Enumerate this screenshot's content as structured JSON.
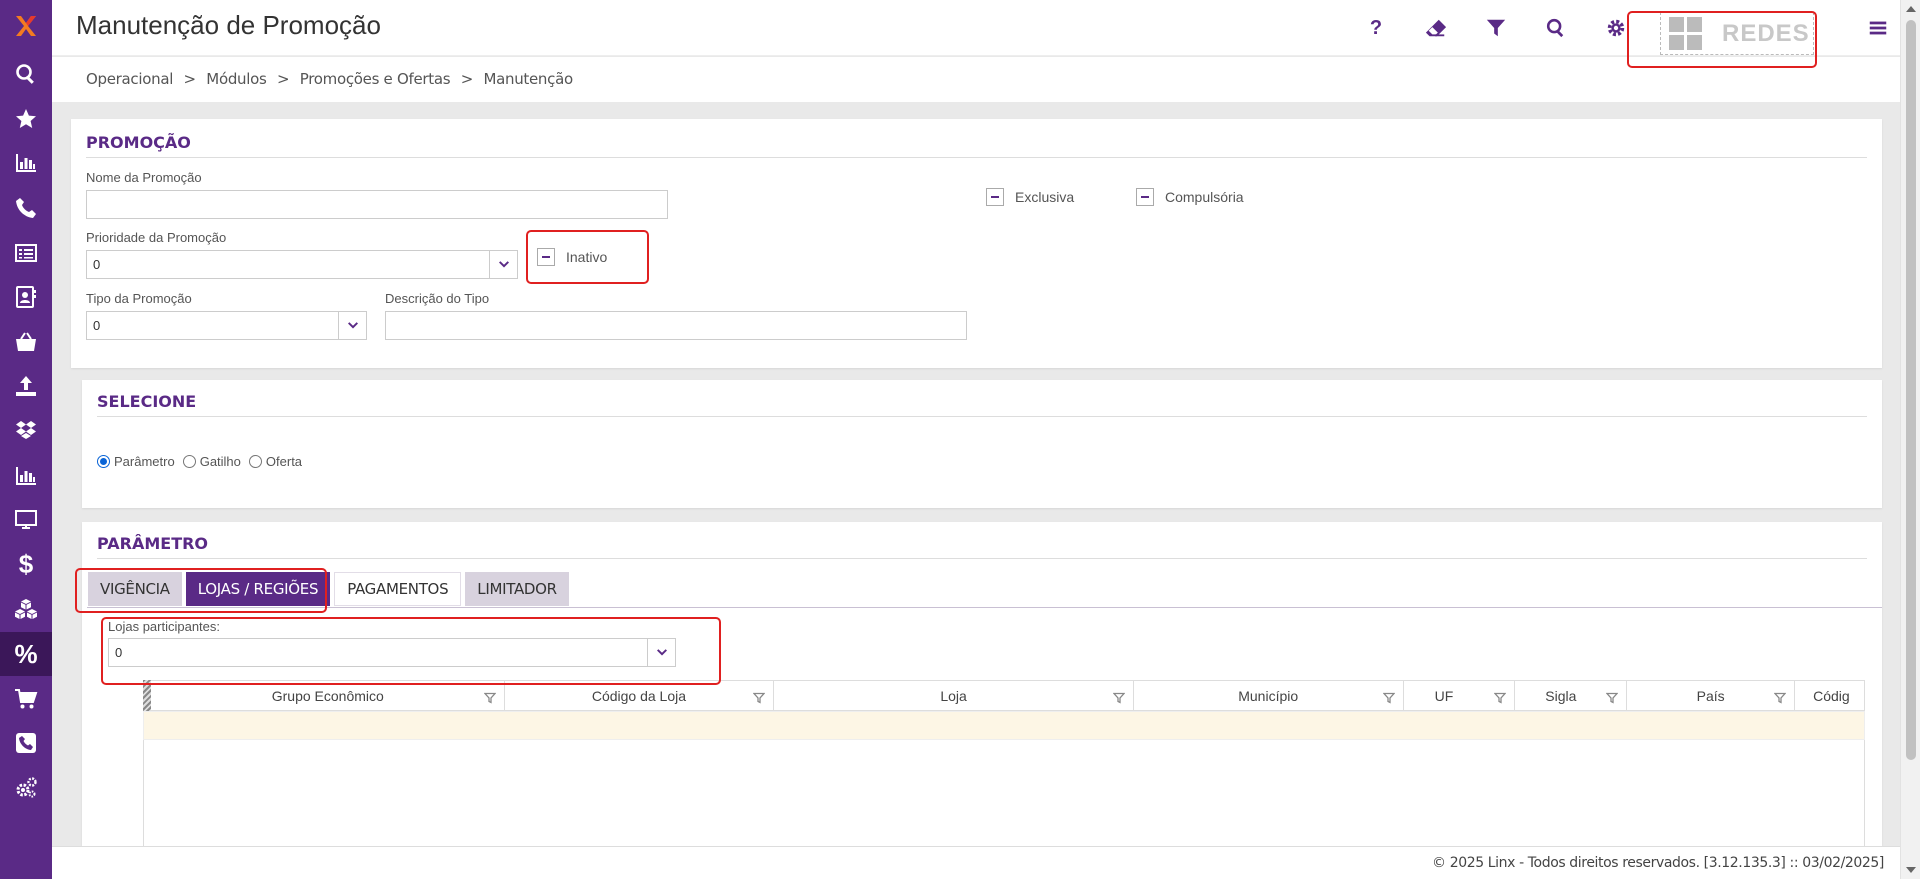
{
  "app": {
    "title": "Manutenção de Promoção",
    "brand_box_label": "REDES"
  },
  "topbar": {
    "icons": [
      "help-icon",
      "eraser-icon",
      "filter-icon",
      "search-icon",
      "gear-icon",
      "menu-icon"
    ],
    "help_glyph": "?"
  },
  "sidebar": {
    "items": [
      "search-icon",
      "star-icon",
      "bar-chart-icon",
      "phone-icon",
      "list-icon",
      "contact-card-icon",
      "basket-icon",
      "upload-icon",
      "dropbox-icon",
      "bar-chart-icon",
      "monitor-icon",
      "dollar-icon",
      "cubes-icon",
      "percent-icon",
      "cart-icon",
      "phone-square-icon",
      "gears-icon"
    ],
    "active_item": "percent-icon",
    "dollar_glyph": "$",
    "percent_glyph": "%"
  },
  "breadcrumb": {
    "items": [
      "Operacional",
      "Módulos",
      "Promoções e Ofertas",
      "Manutenção"
    ],
    "separator": ">"
  },
  "promocao": {
    "section_title": "PROMOÇÃO",
    "nome_label": "Nome da Promoção",
    "nome_value": "",
    "prioridade_label": "Prioridade da Promoção",
    "prioridade_value": "0",
    "inativo_label": "Inativo",
    "exclusiva_label": "Exclusiva",
    "compulsoria_label": "Compulsória",
    "tipo_label": "Tipo da Promoção",
    "tipo_value": "0",
    "descricao_label": "Descrição do Tipo",
    "descricao_value": ""
  },
  "selecione": {
    "section_title": "SELECIONE",
    "options": [
      "Parâmetro",
      "Gatilho",
      "Oferta"
    ],
    "selected": "Parâmetro"
  },
  "parametro": {
    "section_title": "PARÂMETRO",
    "tabs": [
      "VIGÊNCIA",
      "LOJAS / REGIÕES",
      "PAGAMENTOS",
      "LIMITADOR"
    ],
    "active_tab": "LOJAS / REGIÕES",
    "lojas_label": "Lojas participantes:",
    "lojas_value": "0"
  },
  "grid": {
    "columns": [
      "Grupo Econômico",
      "Código da Loja",
      "Loja",
      "Município",
      "UF",
      "Sigla",
      "País",
      "Códig"
    ],
    "rows": []
  },
  "footer": {
    "text": "© 2025 Linx - Todos direitos reservados. [3.12.135.3] :: 03/02/2025]"
  },
  "colors": {
    "brand": "#5a2a86",
    "brand_dark": "#3b1759",
    "highlight": "#e02020",
    "grid_row": "#fdf6e5"
  }
}
